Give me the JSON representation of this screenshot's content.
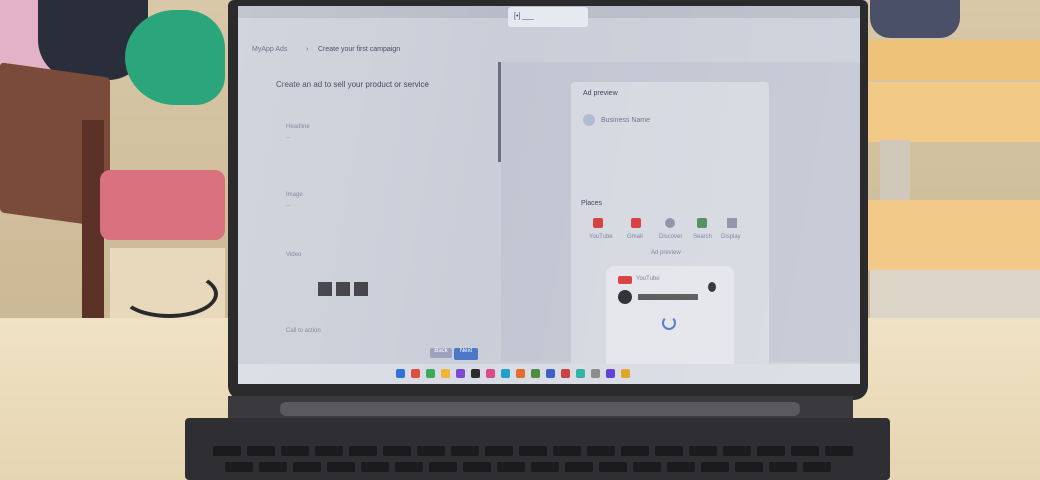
{
  "browser": {
    "tab_label": "[•] ___",
    "app_name": "MyApp Ads",
    "breadcrumb_sep": "›",
    "page_title": "Create your first campaign"
  },
  "left_panel": {
    "heading": "Create an ad to sell your product or service",
    "sections": [
      {
        "label": "Headline",
        "value": "..."
      },
      {
        "label": "Image",
        "value": "..."
      },
      {
        "label": "Video",
        "value": "..."
      },
      {
        "label": "Call to action",
        "value": "..."
      }
    ],
    "buttons": {
      "back": "Back",
      "next": "Next"
    }
  },
  "preview_card": {
    "title": "Ad preview",
    "advertiser": "Business Name",
    "formats_label": "Places",
    "formats": [
      "YouTube",
      "Gmail",
      "Discover",
      "Search",
      "Display"
    ],
    "preview_label": "Ad preview",
    "brand_label": "YouTube"
  },
  "taskbar": {
    "icon_colors": [
      "#2a6fd8",
      "#e04a3a",
      "#3aa85c",
      "#f0b43a",
      "#7a4ad0",
      "#2a2a2a",
      "#d84a8a",
      "#1aa0c8",
      "#e06a2a",
      "#4a8a3a",
      "#3a5ac8",
      "#c83a3a",
      "#2ab0a0",
      "#888888",
      "#5a3ad8",
      "#e0a020"
    ]
  }
}
